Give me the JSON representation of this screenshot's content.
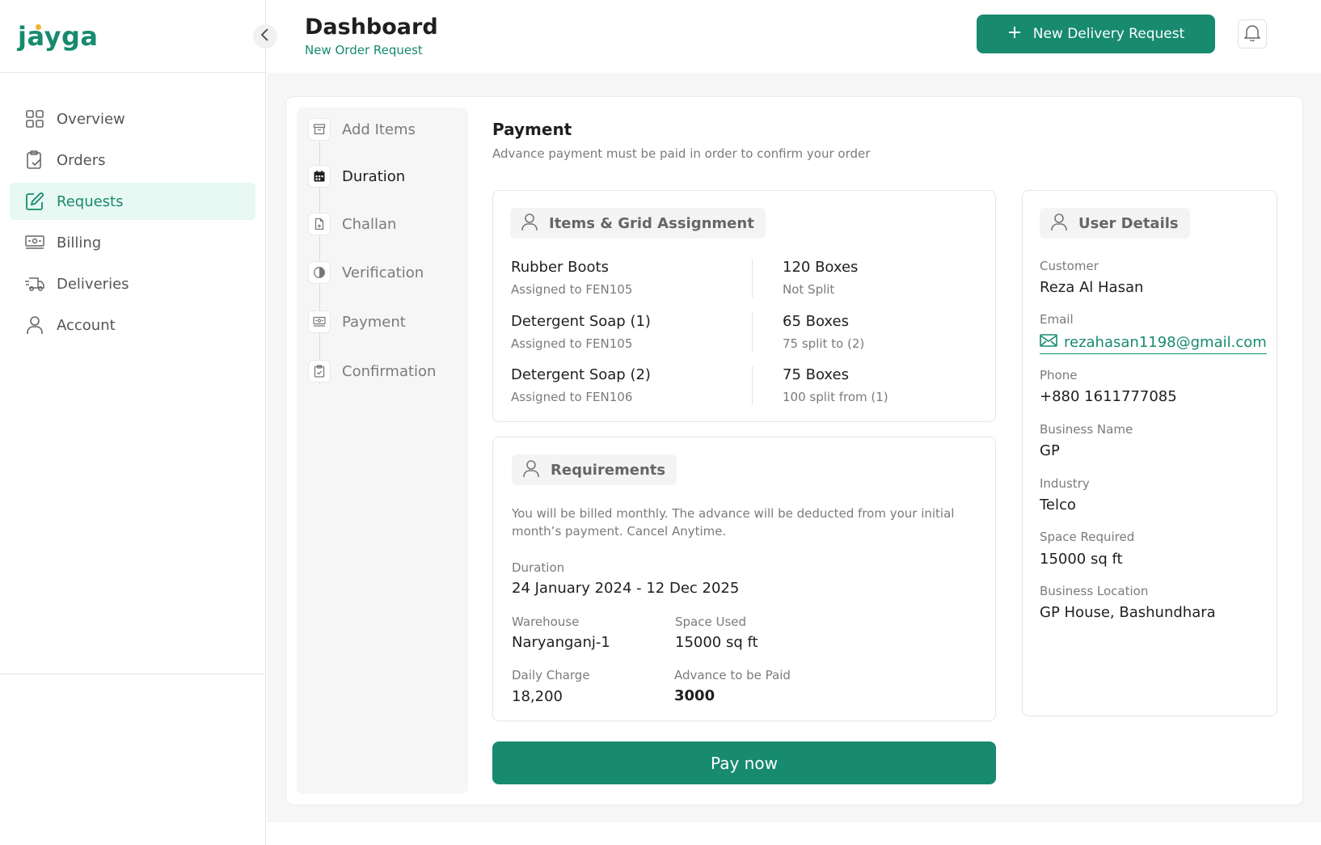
{
  "brand": {
    "name": "jayga",
    "accent": "#178a6f",
    "dot_color": "#f2b632"
  },
  "sidebar": {
    "items": [
      {
        "label": "Overview",
        "icon": "grid-icon"
      },
      {
        "label": "Orders",
        "icon": "clipboard-check-icon"
      },
      {
        "label": "Requests",
        "icon": "edit-icon",
        "active": true
      },
      {
        "label": "Billing",
        "icon": "billing-icon"
      },
      {
        "label": "Deliveries",
        "icon": "truck-icon"
      },
      {
        "label": "Account",
        "icon": "user-icon"
      }
    ]
  },
  "header": {
    "title": "Dashboard",
    "subtitle": "New Order Request",
    "new_delivery_label": "New Delivery Request"
  },
  "stepper": {
    "steps": [
      {
        "label": "Add Items",
        "icon": "archive-icon"
      },
      {
        "label": "Duration",
        "icon": "calendar-icon",
        "current": true
      },
      {
        "label": "Challan",
        "icon": "document-add-icon"
      },
      {
        "label": "Verification",
        "icon": "pie-icon"
      },
      {
        "label": "Payment",
        "icon": "billing-icon"
      },
      {
        "label": "Confirmation",
        "icon": "clipboard-icon"
      }
    ]
  },
  "payment": {
    "title": "Payment",
    "subtitle": "Advance payment must be paid in order to confirm your order"
  },
  "items_panel": {
    "title": "Items & Grid Assignment",
    "rows": [
      {
        "name": "Rubber Boots",
        "assigned": "Assigned to FEN105",
        "qty": "120 Boxes",
        "split": "Not Split"
      },
      {
        "name": "Detergent Soap (1)",
        "assigned": "Assigned to FEN105",
        "qty": "65 Boxes",
        "split": "75 split to (2)"
      },
      {
        "name": "Detergent Soap (2)",
        "assigned": "Assigned to FEN106",
        "qty": "75 Boxes",
        "split": "100 split from (1)"
      }
    ]
  },
  "requirements": {
    "title": "Requirements",
    "note": "You will be billed monthly. The advance will be deducted from your initial month’s payment. Cancel Anytime.",
    "duration_label": "Duration",
    "duration_value": "24 January 2024 - 12 Dec 2025",
    "warehouse_label": "Warehouse",
    "warehouse_value": "Naryanganj-1",
    "space_used_label": "Space Used",
    "space_used_value": "15000 sq ft",
    "daily_charge_label": "Daily Charge",
    "daily_charge_value": "18,200",
    "advance_label": "Advance to be Paid",
    "advance_value": "3000"
  },
  "user_details": {
    "title": "User Details",
    "customer_label": "Customer",
    "customer_value": "Reza Al Hasan",
    "email_label": "Email",
    "email_value": "rezahasan1198@gmail.com",
    "phone_label": "Phone",
    "phone_value": "+880 1611777085",
    "business_label": "Business Name",
    "business_value": "GP",
    "industry_label": "Industry",
    "industry_value": "Telco",
    "space_label": "Space Required",
    "space_value": "15000 sq ft",
    "location_label": "Business Location",
    "location_value": "GP House, Bashundhara"
  },
  "pay_button_label": "Pay now"
}
